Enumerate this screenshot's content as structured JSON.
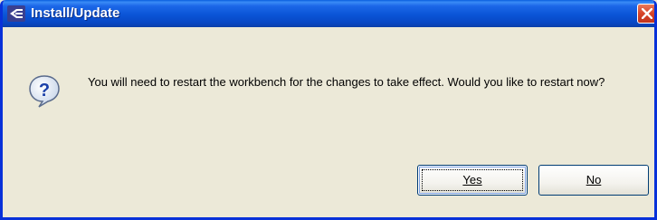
{
  "window": {
    "title": "Install/Update"
  },
  "message": {
    "text": "You will need to restart the workbench for the changes to take effect. Would you like to restart now?"
  },
  "buttons": {
    "yes_label": "Yes",
    "no_label": "No"
  },
  "icons": {
    "title_icon": "eclipse-logo-icon",
    "close_icon": "close-icon",
    "dialog_icon": "question-icon"
  },
  "colors": {
    "titlebar": "#0a54d6",
    "close_button": "#d6442a",
    "dialog_background": "#ece9d8",
    "window_border": "#0831d9"
  }
}
